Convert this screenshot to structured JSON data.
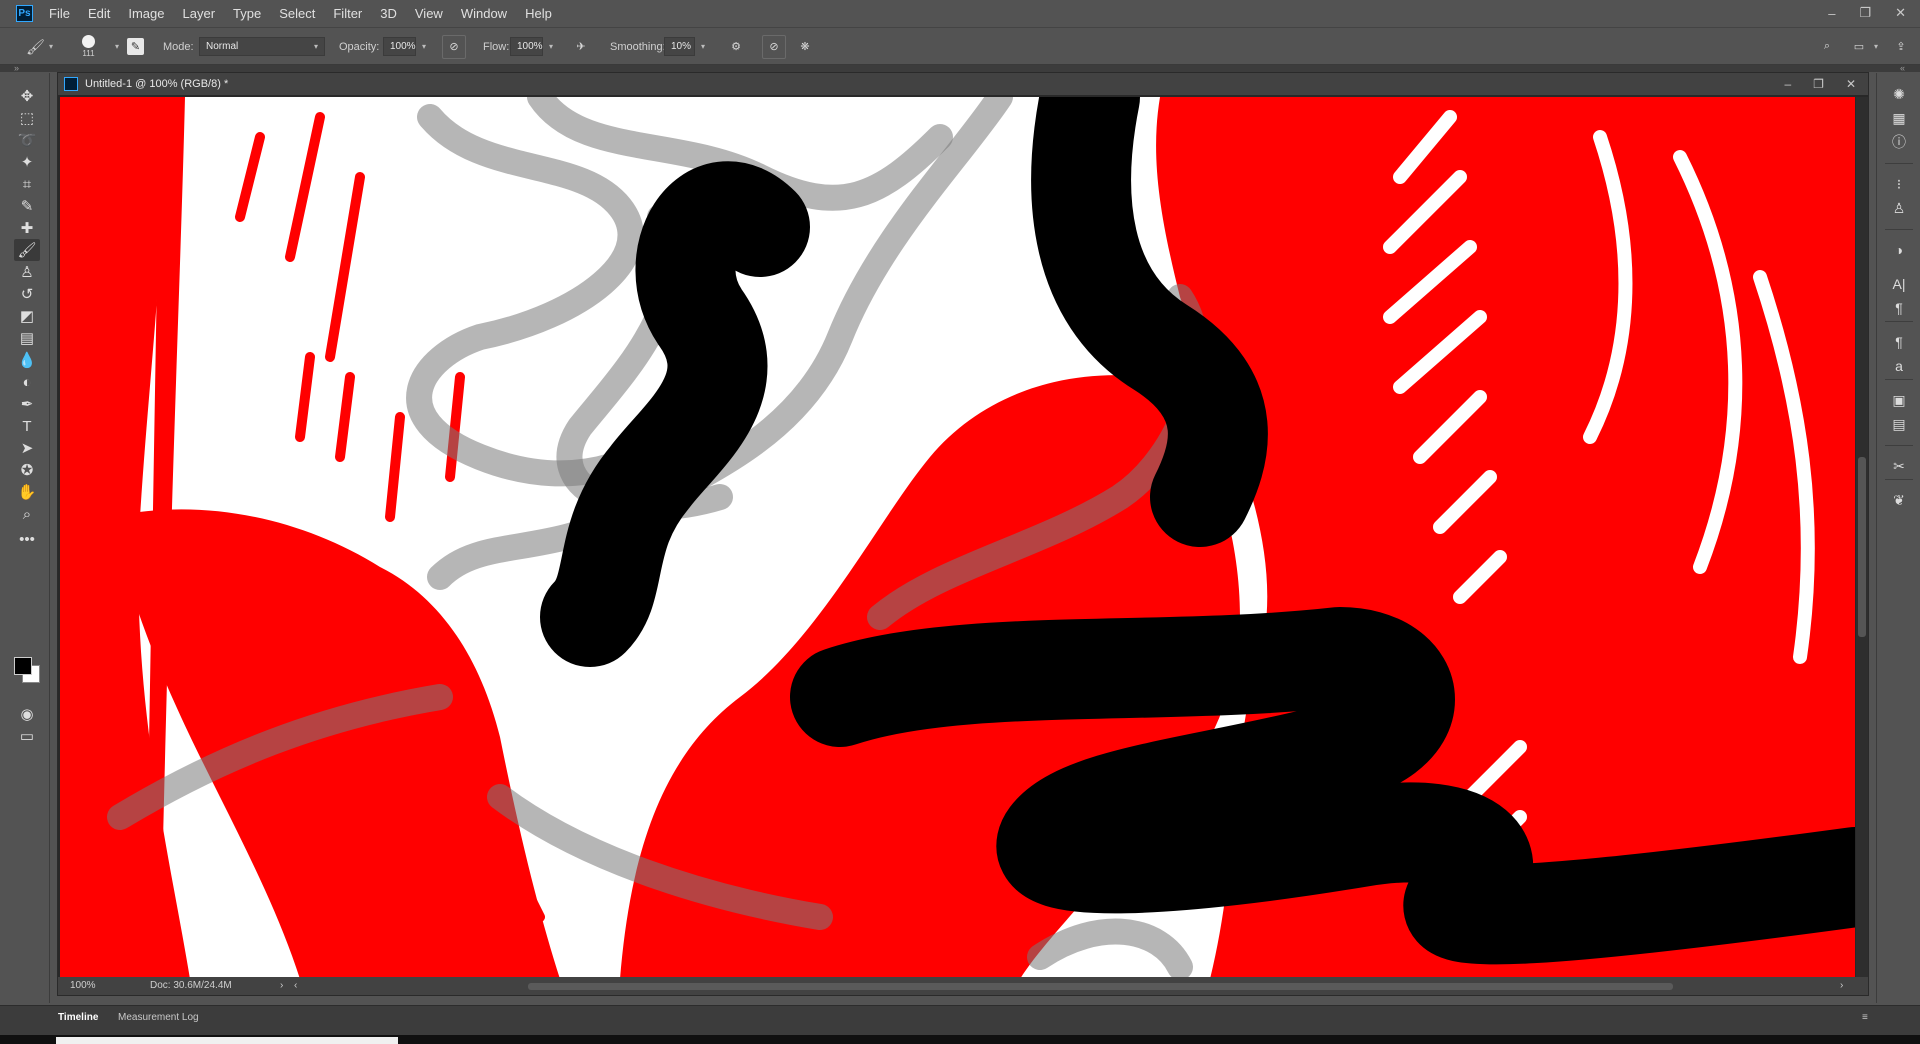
{
  "app": {
    "logo": "Ps"
  },
  "menu": [
    "File",
    "Edit",
    "Image",
    "Layer",
    "Type",
    "Select",
    "Filter",
    "3D",
    "View",
    "Window",
    "Help"
  ],
  "window_controls": {
    "minimize": "–",
    "restore": "❐",
    "close": "✕"
  },
  "options": {
    "brush_size": "111",
    "mode_label": "Mode:",
    "mode_value": "Normal",
    "opacity_label": "Opacity:",
    "opacity_value": "100%",
    "flow_label": "Flow:",
    "flow_value": "100%",
    "smoothing_label": "Smoothing:",
    "smoothing_value": "10%"
  },
  "document": {
    "title": "Untitled-1 @ 100% (RGB/8) *",
    "zoom": "100%",
    "doc_info": "Doc: 30.6M/24.4M"
  },
  "tools": [
    {
      "name": "move-tool-icon",
      "glyph": "✥"
    },
    {
      "name": "marquee-tool-icon",
      "glyph": "⬚"
    },
    {
      "name": "lasso-tool-icon",
      "glyph": "➰"
    },
    {
      "name": "magic-wand-tool-icon",
      "glyph": "✦"
    },
    {
      "name": "crop-tool-icon",
      "glyph": "⌗"
    },
    {
      "name": "eyedropper-tool-icon",
      "glyph": "✎"
    },
    {
      "name": "healing-brush-tool-icon",
      "glyph": "✚"
    },
    {
      "name": "brush-tool-icon",
      "glyph": "🖌"
    },
    {
      "name": "clone-stamp-tool-icon",
      "glyph": "♙"
    },
    {
      "name": "history-brush-tool-icon",
      "glyph": "↺"
    },
    {
      "name": "eraser-tool-icon",
      "glyph": "◩"
    },
    {
      "name": "gradient-tool-icon",
      "glyph": "▤"
    },
    {
      "name": "blur-tool-icon",
      "glyph": "💧"
    },
    {
      "name": "dodge-tool-icon",
      "glyph": "◐"
    },
    {
      "name": "pen-tool-icon",
      "glyph": "✒"
    },
    {
      "name": "type-tool-icon",
      "glyph": "T"
    },
    {
      "name": "path-selection-tool-icon",
      "glyph": "➤"
    },
    {
      "name": "shape-tool-icon",
      "glyph": "✪"
    },
    {
      "name": "hand-tool-icon",
      "glyph": "✋"
    },
    {
      "name": "zoom-tool-icon",
      "glyph": "⌕"
    },
    {
      "name": "more-tools-icon",
      "glyph": "•••"
    }
  ],
  "panels": [
    {
      "name": "color-panel-icon",
      "glyph": "✺"
    },
    {
      "name": "swatches-panel-icon",
      "glyph": "▦"
    },
    {
      "name": "info-panel-icon",
      "glyph": "ⓘ"
    },
    {
      "name": "brush-settings-panel-icon",
      "glyph": "⁝"
    },
    {
      "name": "clone-source-panel-icon",
      "glyph": "♙"
    },
    {
      "name": "adjustments-panel-icon",
      "glyph": "◑"
    },
    {
      "name": "character-panel-icon",
      "glyph": "A|"
    },
    {
      "name": "paragraph-panel-icon",
      "glyph": "¶"
    },
    {
      "name": "paragraph-styles-panel-icon",
      "glyph": "¶"
    },
    {
      "name": "character-styles-panel-icon",
      "glyph": "a"
    },
    {
      "name": "layers-panel-icon",
      "glyph": "▣"
    },
    {
      "name": "notes-panel-icon",
      "glyph": "▤"
    },
    {
      "name": "tool-presets-panel-icon",
      "glyph": "✂"
    },
    {
      "name": "paths-panel-icon",
      "glyph": "❦"
    }
  ],
  "bottom_tabs": [
    "Timeline",
    "Measurement Log"
  ],
  "colors": {
    "canvas_red": "#ff0000",
    "canvas_white": "#ffffff",
    "stroke_black": "#000000",
    "stroke_gray": "#808080",
    "ui_background": "#535353"
  }
}
